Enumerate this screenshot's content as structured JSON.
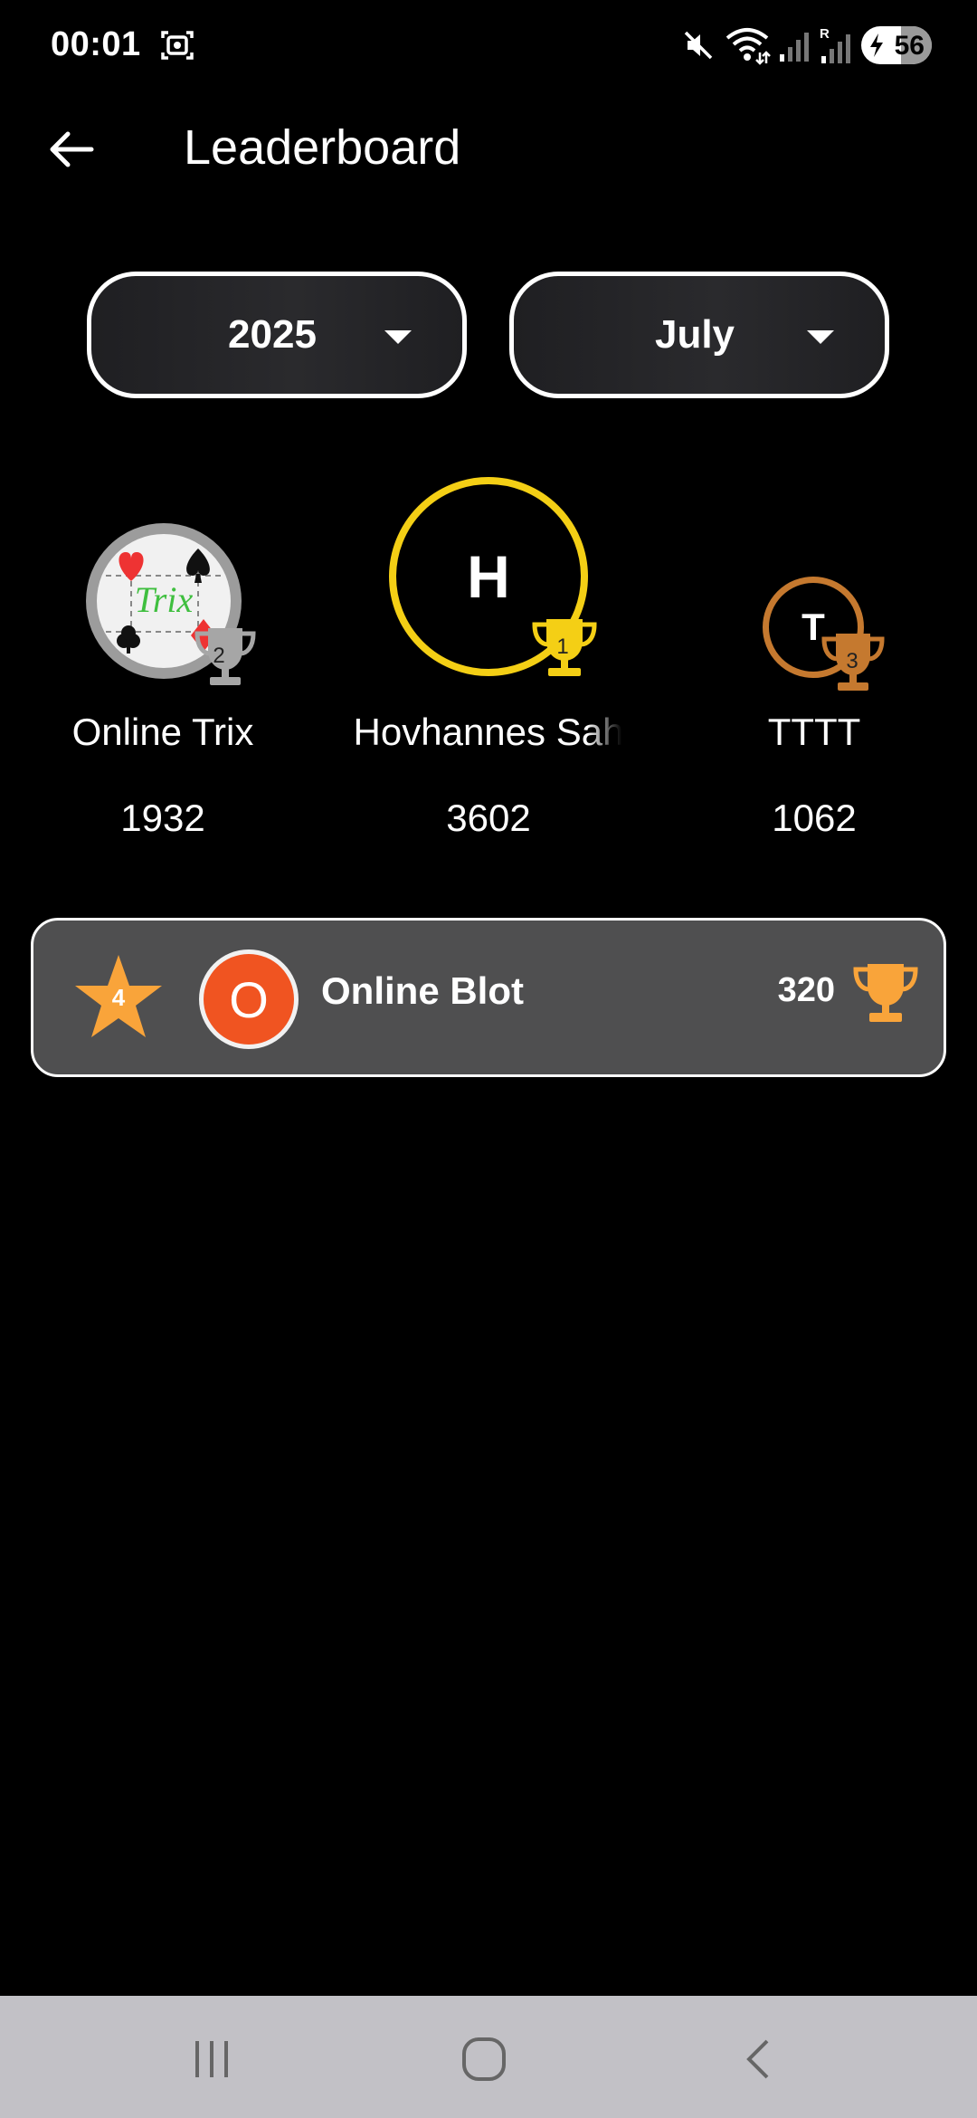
{
  "status_bar": {
    "time": "00:01",
    "battery_percent": "56",
    "icons": [
      "screen-record-icon",
      "mute-icon",
      "wifi-icon",
      "signal-icon",
      "signal-roaming-icon",
      "battery-charging-icon"
    ],
    "roaming_letter": "R"
  },
  "header": {
    "title": "Leaderboard",
    "back_icon": "arrow-left-icon"
  },
  "filters": {
    "year": "2025",
    "month": "July"
  },
  "podium": [
    {
      "rank": "2",
      "name": "Online Trix",
      "score": "1932",
      "avatar_type": "image",
      "color": "#9e9e9e"
    },
    {
      "rank": "1",
      "name": "Hovhannes Sah",
      "score": "3602",
      "avatar_letter": "H",
      "color": "#f4cf15"
    },
    {
      "rank": "3",
      "name": "TTTT",
      "score": "1062",
      "avatar_letter": "T",
      "color": "#c5792f"
    }
  ],
  "trix_logo_text": "Trix",
  "my_entry": {
    "rank": "4",
    "avatar_letter": "O",
    "name": "Online Blot",
    "score": "320",
    "star_color": "#f9a43a",
    "avatar_color": "#f05421",
    "trophy_color": "#f9a43a"
  },
  "navbar": {
    "icons": [
      "recent-apps-icon",
      "home-icon",
      "back-nav-icon"
    ]
  }
}
